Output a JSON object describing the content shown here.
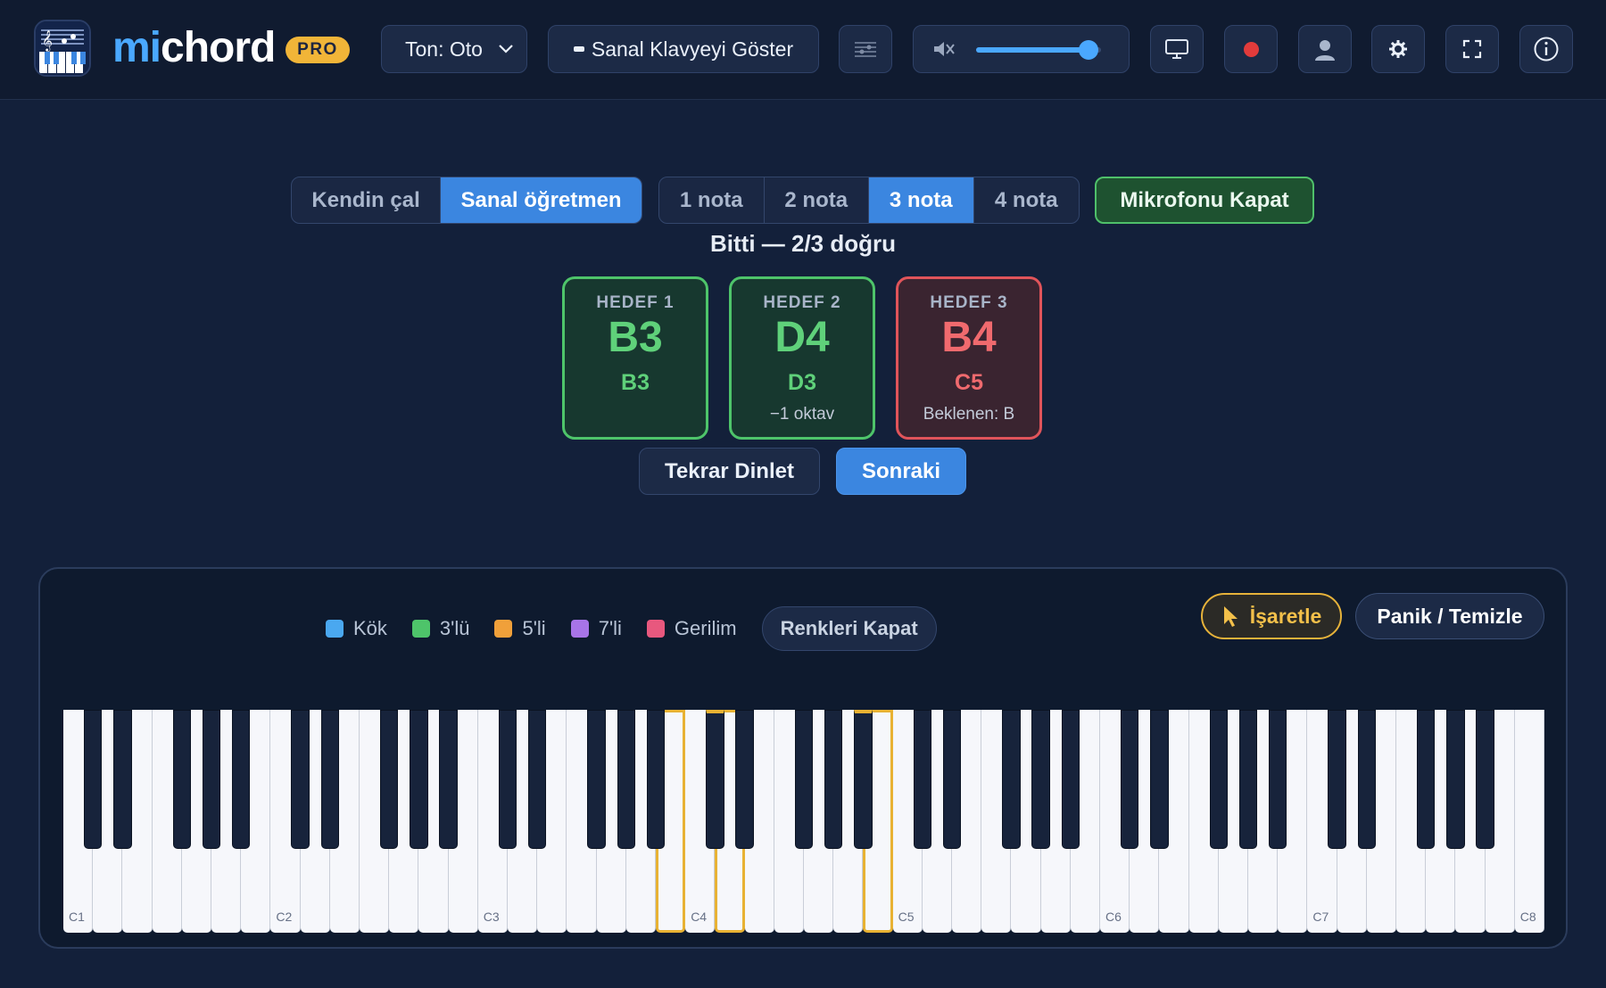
{
  "header": {
    "app_name_prefix": "mi",
    "app_name_suffix": "chord",
    "badge": "PRO",
    "tone_select": "Ton: Oto",
    "keyboard_button": "Sanal Klavyeyi Göster",
    "volume_percent": 90,
    "accent_color": "#3b86e0"
  },
  "mode": {
    "options": [
      "Kendin çal",
      "Sanal öğretmen"
    ],
    "selected": "Sanal öğretmen"
  },
  "note_count": {
    "options": [
      "1 nota",
      "2 nota",
      "3 nota",
      "4 nota"
    ],
    "selected": "3 nota"
  },
  "mic_button": "Mikrofonu Kapat",
  "status": "Bitti — 2/3 doğru",
  "targets": [
    {
      "label": "HEDEF 1",
      "target": "B3",
      "played": "B3",
      "note": "",
      "result": "correct"
    },
    {
      "label": "HEDEF 2",
      "target": "D4",
      "played": "D3",
      "note": "−1 oktav",
      "result": "correct"
    },
    {
      "label": "HEDEF 3",
      "target": "B4",
      "played": "C5",
      "note": "Beklenen: B",
      "result": "wrong"
    }
  ],
  "actions": {
    "replay": "Tekrar Dinlet",
    "next": "Sonraki"
  },
  "legend": [
    {
      "label": "Kök",
      "color": "#4aa8f0"
    },
    {
      "label": "3'lü",
      "color": "#4ec46a"
    },
    {
      "label": "5'li",
      "color": "#f0a03a"
    },
    {
      "label": "7'li",
      "color": "#a874e8"
    },
    {
      "label": "Gerilim",
      "color": "#e8587e"
    }
  ],
  "colors_toggle": "Renkleri Kapat",
  "mark_button": "İşaretle",
  "panic_button": "Panik / Temizle",
  "keyboard": {
    "octave_labels": [
      "C1",
      "C2",
      "C3",
      "C4",
      "C5",
      "C6",
      "C7",
      "C8"
    ],
    "highlighted_keys": [
      "B3",
      "C#4",
      "D4",
      "A#4",
      "B4"
    ],
    "highlight_color": "#e8b233"
  }
}
